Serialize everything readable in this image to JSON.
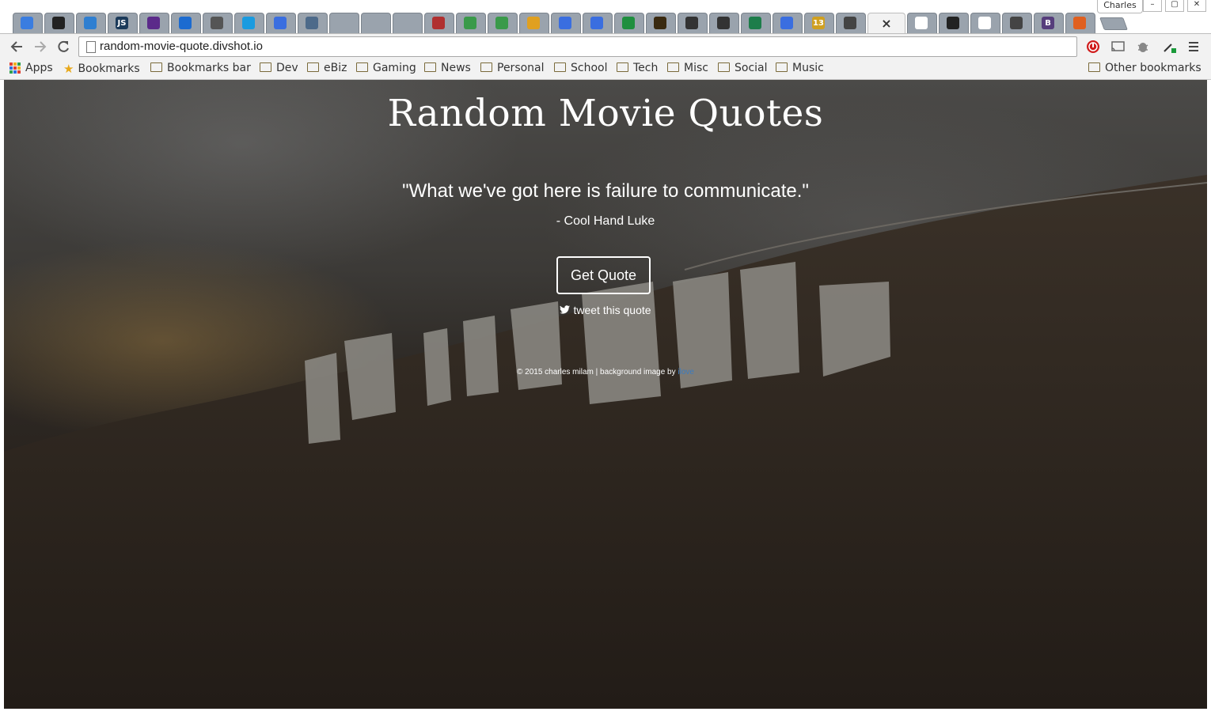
{
  "browser": {
    "profile_name": "Charles",
    "window_controls": {
      "minimize": "–",
      "maximize": "▢",
      "close": "✕"
    },
    "active_tab_close": "×",
    "tabs": [
      {
        "icon": "mail-check-icon",
        "color": "#3a7de0"
      },
      {
        "icon": "github-icon",
        "color": "#222222"
      },
      {
        "icon": "circle-icon",
        "color": "#2f7fd1"
      },
      {
        "icon": "js-icon",
        "color": "#1b3a5a",
        "glyph": "JS"
      },
      {
        "icon": "peace-icon",
        "color": "#5b2a8a"
      },
      {
        "icon": "bookmark-square-icon",
        "color": "#1c6bd0"
      },
      {
        "icon": "peace-hand-icon",
        "color": "#555555"
      },
      {
        "icon": "chat-bubble-icon",
        "color": "#1a9be0"
      },
      {
        "icon": "docs-icon",
        "color": "#3a6ee0"
      },
      {
        "icon": "store-icon",
        "color": "#4d6a8a"
      },
      {
        "icon": "blank-icon",
        "color": "#9aa3ad"
      },
      {
        "icon": "blank-icon",
        "color": "#9aa3ad"
      },
      {
        "icon": "blank-icon",
        "color": "#9aa3ad"
      },
      {
        "icon": "slides-icon",
        "color": "#b03030"
      },
      {
        "icon": "green-circle-icon",
        "color": "#3a9a4a"
      },
      {
        "icon": "green-circle-icon",
        "color": "#3a9a4a"
      },
      {
        "icon": "drive-icon",
        "color": "#e0a020"
      },
      {
        "icon": "docs-icon",
        "color": "#3a6ee0"
      },
      {
        "icon": "docs-icon",
        "color": "#3a6ee0"
      },
      {
        "icon": "sheets-icon",
        "color": "#1f8f3f"
      },
      {
        "icon": "amazon-icon",
        "color": "#3a2a10"
      },
      {
        "icon": "codepen-icon",
        "color": "#333333"
      },
      {
        "icon": "codepen-icon",
        "color": "#333333"
      },
      {
        "icon": "green-square-icon",
        "color": "#1d7d4a"
      },
      {
        "icon": "moon-icon",
        "color": "#3a6ee0"
      },
      {
        "icon": "badge-13-icon",
        "color": "#d0a020",
        "glyph": "13"
      },
      {
        "icon": "code-icon",
        "color": "#444444"
      },
      {
        "icon": "close-icon",
        "active": true
      },
      {
        "icon": "wordpress-icon",
        "color": "#ffffff"
      },
      {
        "icon": "github-icon",
        "color": "#222222"
      },
      {
        "icon": "file-icon",
        "color": "#ffffff"
      },
      {
        "icon": "code-icon",
        "color": "#444444"
      },
      {
        "icon": "bootstrap-icon",
        "color": "#563d7c",
        "glyph": "B"
      },
      {
        "icon": "html5-icon",
        "color": "#e06020"
      }
    ],
    "url": "random-movie-quote.divshot.io",
    "bookmarks": {
      "apps": "Apps",
      "items": [
        "Bookmarks",
        "Bookmarks bar",
        "Dev",
        "eBiz",
        "Gaming",
        "News",
        "Personal",
        "School",
        "Tech",
        "Misc",
        "Social",
        "Music"
      ],
      "other": "Other bookmarks"
    }
  },
  "page": {
    "title": "Random Movie Quotes",
    "quote": "\"What we've got here is failure to communicate.\"",
    "source": "- Cool Hand Luke",
    "button_label": "Get Quote",
    "tweet_label": "tweet this quote",
    "footer_text": "© 2015 charles milam | background image by ",
    "footer_link": "ilove"
  }
}
